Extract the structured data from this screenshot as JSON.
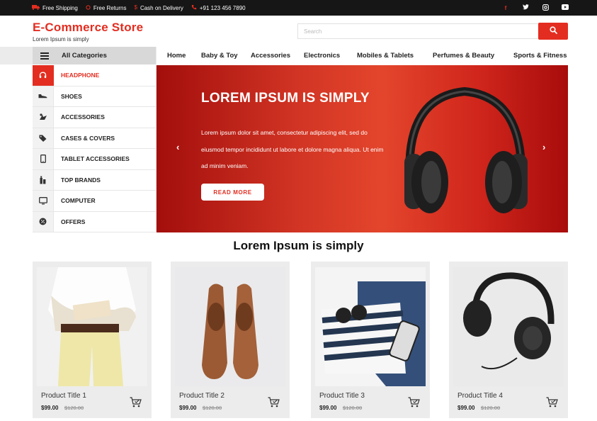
{
  "topbar": {
    "items": [
      {
        "icon": "truck-icon",
        "label": "Free Shipping"
      },
      {
        "icon": "return-icon",
        "label": "Free Returns"
      },
      {
        "icon": "dollar-icon",
        "label": "Cash on Delivery"
      },
      {
        "icon": "phone-icon",
        "label": "+91 123 456 7890"
      }
    ],
    "social": [
      {
        "icon": "facebook-icon",
        "glyph": "f"
      },
      {
        "icon": "twitter-icon",
        "glyph": "t"
      },
      {
        "icon": "instagram-icon",
        "glyph": "◎"
      },
      {
        "icon": "youtube-icon",
        "glyph": "▶"
      }
    ]
  },
  "header": {
    "brand": "E-Commerce Store",
    "tagline": "Lorem Ipsum is simply",
    "search_placeholder": "Search"
  },
  "nav": {
    "all_categories": "All Categories",
    "menu": [
      "Home",
      "Baby & Toy",
      "Accessories",
      "Electronics",
      "Mobiles & Tablets",
      "Perfumes & Beauty",
      "Sports & Fitness"
    ]
  },
  "sidebar": {
    "items": [
      {
        "label": "HEADPHONE",
        "icon": "headphone-icon",
        "active": true
      },
      {
        "label": "SHOES",
        "icon": "shoe-icon"
      },
      {
        "label": "ACCESSORIES",
        "icon": "accessories-icon"
      },
      {
        "label": "CASES & COVERS",
        "icon": "tag-icon"
      },
      {
        "label": "TABLET ACCESSORIES",
        "icon": "tablet-icon"
      },
      {
        "label": "TOP BRANDS",
        "icon": "brands-icon"
      },
      {
        "label": "COMPUTER",
        "icon": "monitor-icon"
      },
      {
        "label": "OFFERS",
        "icon": "offer-icon"
      }
    ]
  },
  "hero": {
    "title": "LOREM IPSUM IS SIMPLY",
    "text": "Lorem ipsum dolor sit amet, consectetur adipiscing elit, sed do eiusmod tempor incididunt ut labore et dolore magna aliqua. Ut enim ad minim veniam.",
    "button": "READ MORE",
    "prev": "‹",
    "next": "›"
  },
  "section_title": "Lorem Ipsum is simply",
  "products": [
    {
      "title": "Product Title 1",
      "price": "$99.00",
      "old_price": "$120.00"
    },
    {
      "title": "Product Title 2",
      "price": "$99.00",
      "old_price": "$120.00"
    },
    {
      "title": "Product Title 3",
      "price": "$99.00",
      "old_price": "$120.00"
    },
    {
      "title": "Product Title 4",
      "price": "$99.00",
      "old_price": "$120.00"
    }
  ],
  "colors": {
    "accent": "#e32d20",
    "topbar": "#161616"
  }
}
